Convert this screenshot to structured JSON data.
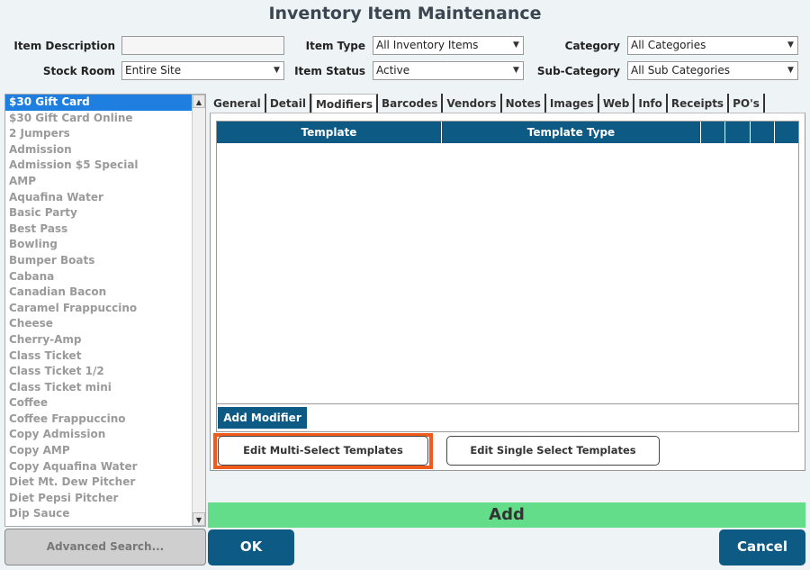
{
  "window": {
    "title": "Inventory Item Maintenance"
  },
  "filters": {
    "item_description": {
      "label": "Item Description",
      "value": ""
    },
    "stock_room": {
      "label": "Stock Room",
      "value": "Entire Site"
    },
    "item_type": {
      "label": "Item Type",
      "value": "All Inventory Items"
    },
    "item_status": {
      "label": "Item Status",
      "value": "Active"
    },
    "category": {
      "label": "Category",
      "value": "All Categories"
    },
    "sub_category": {
      "label": "Sub-Category",
      "value": "All Sub Categories"
    }
  },
  "item_list": {
    "selected_index": 0,
    "items": [
      "$30 Gift Card",
      "$30 Gift Card Online",
      "2 Jumpers",
      "Admission",
      "Admission $5 Special",
      "AMP",
      "Aquafina Water",
      "Basic Party",
      "Best Pass",
      "Bowling",
      "Bumper Boats",
      "Cabana",
      "Canadian Bacon",
      "Caramel Frappuccino",
      "Cheese",
      "Cherry-Amp",
      "Class Ticket",
      "Class Ticket 1/2",
      "Class Ticket mini",
      "Coffee",
      "Coffee Frappuccino",
      "Copy Admission",
      "Copy AMP",
      "Copy Aquafina Water",
      "Diet Mt. Dew Pitcher",
      "Diet Pepsi Pitcher",
      "Dip Sauce"
    ]
  },
  "tabs": {
    "active": "Modifiers",
    "items": [
      "General",
      "Detail",
      "Modifiers",
      "Barcodes",
      "Vendors",
      "Notes",
      "Images",
      "Web",
      "Info",
      "Receipts",
      "PO's"
    ]
  },
  "modifiers_grid": {
    "columns": [
      "Template",
      "Template Type",
      "",
      "",
      "",
      ""
    ],
    "rows": []
  },
  "buttons": {
    "add_modifier": "Add Modifier",
    "edit_multi": "Edit Multi-Select Templates",
    "edit_single": "Edit Single Select Templates",
    "add": "Add",
    "advanced_search": "Advanced Search...",
    "ok": "OK",
    "cancel": "Cancel"
  },
  "colors": {
    "accent": "#0d5a85",
    "add_bar": "#63dd8a",
    "highlight": "#f05a1a",
    "selection": "#1e7fe0"
  }
}
